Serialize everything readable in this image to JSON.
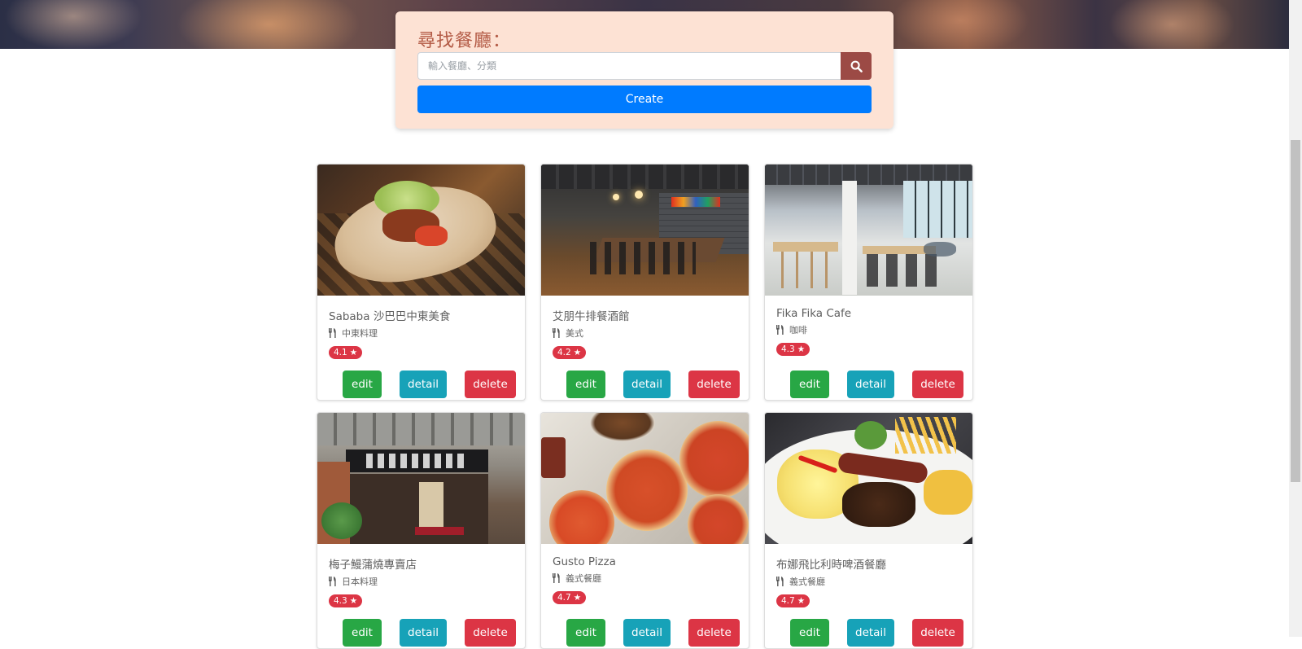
{
  "search": {
    "title": "尋找餐廳：",
    "placeholder": "輸入餐廳、分類",
    "search_icon": "search-icon",
    "create_label": "Create"
  },
  "restaurants": [
    {
      "name": "Sababa 沙巴巴中東美食",
      "category": "中東料理",
      "rating": "4.1",
      "image_icon": "food-photo"
    },
    {
      "name": "艾朋牛排餐酒館",
      "category": "美式",
      "rating": "4.2",
      "image_icon": "restaurant-interior-photo"
    },
    {
      "name": "Fika Fika Cafe",
      "category": "咖啡",
      "rating": "4.3",
      "image_icon": "cafe-interior-photo"
    },
    {
      "name": "梅子鰻蒲燒專賣店",
      "category": "日本料理",
      "rating": "4.3",
      "image_icon": "storefront-photo"
    },
    {
      "name": "Gusto Pizza",
      "category": "義式餐廳",
      "rating": "4.7",
      "image_icon": "pizza-photo"
    },
    {
      "name": "布娜飛比利時啤酒餐廳",
      "category": "義式餐廳",
      "rating": "4.7",
      "image_icon": "plate-photo"
    }
  ],
  "actions": {
    "edit_label": "edit",
    "detail_label": "detail",
    "delete_label": "delete"
  },
  "colors": {
    "search_panel": "#fde2d4",
    "search_title": "#b35a45",
    "search_button": "#9c4a45",
    "create_button": "#007bff",
    "edit": "#28a745",
    "detail": "#17a2b8",
    "delete": "#dc3545",
    "rating_badge": "#dc3545"
  }
}
